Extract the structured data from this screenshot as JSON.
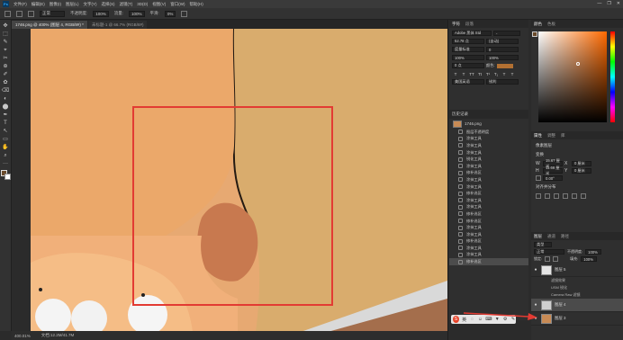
{
  "menubar": {
    "logo": "Ps",
    "items": [
      "文件(F)",
      "编辑(E)",
      "图像(I)",
      "图层(L)",
      "文字(Y)",
      "选择(S)",
      "滤镜(T)",
      "3D(D)",
      "视图(V)",
      "窗口(W)",
      "帮助(H)"
    ],
    "window_controls": [
      "—",
      "❐",
      "✕"
    ]
  },
  "optionsbar": {
    "mode_value": "正常",
    "opacity_label": "不透明度:",
    "opacity_value": "100%",
    "flow_label": "流量:",
    "flow_value": "100%",
    "smoothing_label": "平滑:",
    "smoothing_value": "0%"
  },
  "tabs": [
    {
      "label": "1746.png @ 400% (图层 4, RGB/8#) *",
      "active": true
    },
    {
      "label": "未标题-1 @ 66.7% (RGB/8#)",
      "active": false
    }
  ],
  "tools": [
    "✥",
    "⬚",
    "✎",
    "⌖",
    "✂",
    "⊕",
    "✐",
    "✿",
    "⌫",
    "◐",
    "⬤",
    "✒",
    "T",
    "↖",
    "▭",
    "✋",
    "⌕",
    "···"
  ],
  "statusbar": {
    "zoom": "400.01%",
    "doc_info": "文档:12.2M/41.7M"
  },
  "character_panel": {
    "tabs": [
      "字符",
      "段落"
    ],
    "font_family": "Adobe 黑体 Std",
    "font_style": "-",
    "font_size": "52.78 点",
    "leading": "(自动)",
    "kerning": "度量标准",
    "tracking": "0",
    "vertical_scale": "100%",
    "horizontal_scale": "100%",
    "baseline_shift": "0 点",
    "text_color_label": "颜色:",
    "fx_buttons": [
      "T",
      "T",
      "TT",
      "Tt",
      "T¹",
      "T₁",
      "T",
      "T"
    ],
    "language": "美国英语",
    "antialias": "锐利"
  },
  "history_panel": {
    "title": "历史记录",
    "snapshot": "1746.png",
    "items": [
      "图层不透明度",
      "涂抹工具",
      "涂抹工具",
      "涂抹工具",
      "锐化工具",
      "涂抹工具",
      "修补选区",
      "涂抹工具",
      "涂抹工具",
      "修补选区",
      "涂抹工具",
      "涂抹工具",
      "修补选区",
      "修补选区",
      "涂抹工具",
      "涂抹工具",
      "修补选区",
      "涂抹工具",
      "涂抹工具",
      "修补选区"
    ],
    "active_index": 19
  },
  "color_panel": {
    "tabs": [
      "颜色",
      "色板"
    ],
    "foreground": "#6a4a2a",
    "background": "#ffffff"
  },
  "properties_panel": {
    "tabs": [
      "属性",
      "调整",
      "库"
    ],
    "kind": "像素图层",
    "transform_label": "变换",
    "w_label": "W",
    "w_value": "15.67 厘米",
    "h_label": "H",
    "h_value": "11.66 厘米",
    "x_label": "X",
    "x_value": "0 厘米",
    "y_label": "Y",
    "y_value": "0 厘米",
    "angle_value": "0.00°",
    "align_label": "对齐并分布"
  },
  "layers_panel": {
    "tabs": [
      "图层",
      "通道",
      "路径"
    ],
    "filter_label": "类型",
    "blend_mode": "正常",
    "opacity_label": "不透明度:",
    "opacity_value": "100%",
    "lock_label": "锁定:",
    "fill_label": "填充:",
    "fill_value": "100%",
    "layers": [
      {
        "name": "图层 5",
        "visible": true,
        "selected": false
      },
      {
        "name": "图层 4",
        "visible": true,
        "selected": true
      },
      {
        "name": "图层 3",
        "visible": true,
        "selected": false
      }
    ],
    "sublayers": [
      "滤镜效果",
      "USM 锐化",
      "Camera Raw 滤镜"
    ]
  },
  "ime": {
    "logo": "S",
    "items": [
      "英",
      "◌",
      "☺",
      "⌨",
      "▼",
      "⚙",
      "✎"
    ]
  }
}
